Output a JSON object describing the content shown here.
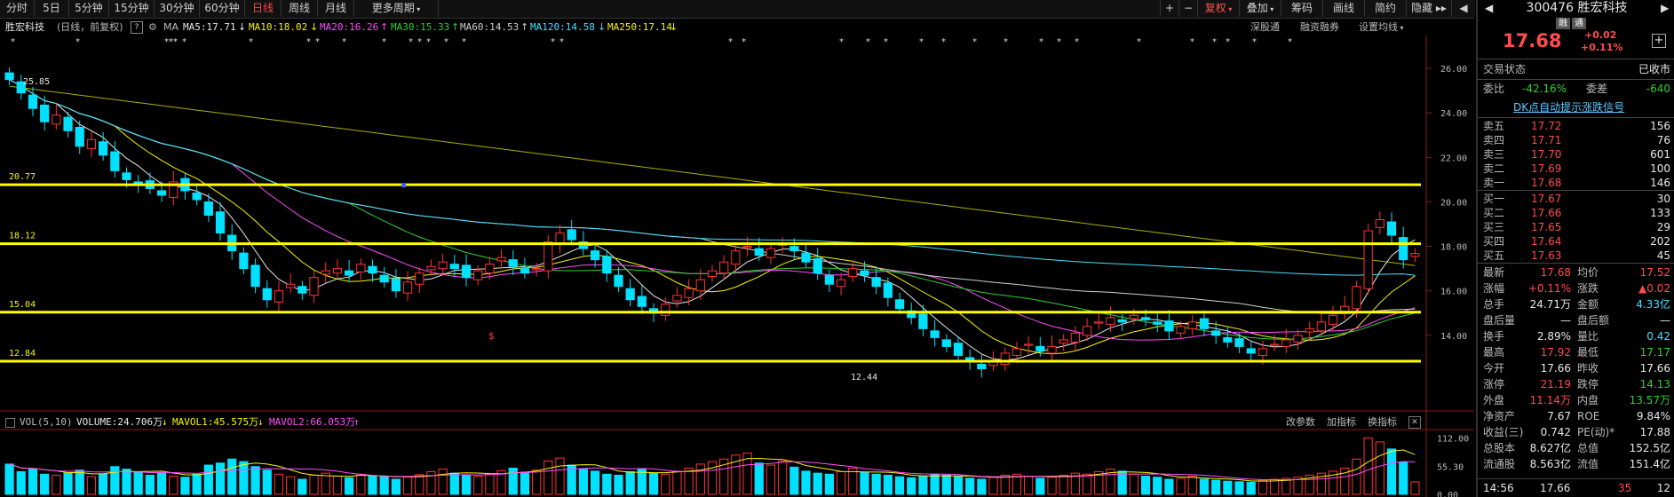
{
  "toolbar": {
    "periods": [
      "分时",
      "5日",
      "5分钟",
      "15分钟",
      "30分钟",
      "60分钟",
      "日线",
      "周线",
      "月线",
      "更多周期"
    ],
    "active_period": "日线",
    "right_items": [
      "+",
      "−",
      "复权",
      "叠加",
      "筹码",
      "画线",
      "简约",
      "隐藏"
    ],
    "active_right": "复权",
    "hide_arrow": "▸▸"
  },
  "infobar": {
    "name": "胜宏科技",
    "mode": "(日线，前复权)",
    "help": "?",
    "ma_label": "MA",
    "ma": [
      {
        "text": "MA5:17.71",
        "arrow": "↓",
        "color": "#e8e8e8"
      },
      {
        "text": "MA10:18.02",
        "arrow": "↓",
        "color": "#f6f600"
      },
      {
        "text": "MA20:16.26",
        "arrow": "↑",
        "color": "#ff4cff"
      },
      {
        "text": "MA30:15.33",
        "arrow": "↑",
        "color": "#2fd12f"
      },
      {
        "text": "MA60:14.53",
        "arrow": "↑",
        "color": "#cfcfcf"
      },
      {
        "text": "MA120:14.58",
        "arrow": "↓",
        "color": "#45e0ff"
      },
      {
        "text": "MA250:17.14",
        "arrow": "↓",
        "color": "#f6f600"
      }
    ],
    "right_links": [
      "深股通",
      "融资融券",
      "设置均线"
    ]
  },
  "price_levels": [
    {
      "value": 20.77,
      "label": "20.77"
    },
    {
      "value": 18.12,
      "label": "18.12"
    },
    {
      "value": 15.04,
      "label": "15.04"
    },
    {
      "value": 12.84,
      "label": "12.84"
    }
  ],
  "price_annotations": {
    "high": "25.85",
    "low": "12.44"
  },
  "price_axis": [
    "26.00",
    "24.00",
    "22.00",
    "20.00",
    "18.00",
    "16.00",
    "14.00"
  ],
  "vol_bar": {
    "label": "VOL(5,10)",
    "volume": "VOLUME:24.706万",
    "mavol1": "MAVOL1:45.575万",
    "mavol2": "MAVOL2:66.053万",
    "mavol1_arrow": "↓",
    "mavol2_arrow": "↑",
    "links": [
      "改参数",
      "加指标",
      "换指标"
    ],
    "close": "✕"
  },
  "vol_axis": [
    "112.00",
    "55.30",
    "0.00"
  ],
  "chart_data": {
    "type": "candlestick",
    "price_range": [
      12.44,
      25.85
    ],
    "closes": [
      25.5,
      24.9,
      24.2,
      23.6,
      23.9,
      23.2,
      22.5,
      22.8,
      22.1,
      21.4,
      21.0,
      20.8,
      20.6,
      20.3,
      20.9,
      20.5,
      20.1,
      19.4,
      18.6,
      17.8,
      17.0,
      16.2,
      15.6,
      16.0,
      16.3,
      15.9,
      16.6,
      16.9,
      17.0,
      16.7,
      17.2,
      16.8,
      16.4,
      16.0,
      16.4,
      16.8,
      17.1,
      17.3,
      17.0,
      16.6,
      16.9,
      17.2,
      17.5,
      17.1,
      16.8,
      17.0,
      18.2,
      18.6,
      18.3,
      17.9,
      17.4,
      16.8,
      16.2,
      15.6,
      15.3,
      15.0,
      15.4,
      15.8,
      16.1,
      16.5,
      16.9,
      17.3,
      17.8,
      18.0,
      17.6,
      17.9,
      18.1,
      17.8,
      17.3,
      16.8,
      16.3,
      16.5,
      17.0,
      16.7,
      16.2,
      15.7,
      15.2,
      14.8,
      14.3,
      13.9,
      13.5,
      13.1,
      12.8,
      12.5,
      12.8,
      13.2,
      13.4,
      13.6,
      13.3,
      13.5,
      13.8,
      14.1,
      14.4,
      14.6,
      14.8,
      14.6,
      14.9,
      14.7,
      14.5,
      14.2,
      14.4,
      14.6,
      14.3,
      14.0,
      13.7,
      13.5,
      13.2,
      13.4,
      13.6,
      13.8,
      14.0,
      14.3,
      14.6,
      14.9,
      15.3,
      16.2,
      18.7,
      19.2,
      18.5,
      17.4,
      17.68
    ],
    "volumes_wan": [
      60,
      45,
      50,
      40,
      38,
      42,
      48,
      35,
      40,
      55,
      50,
      45,
      38,
      42,
      36,
      34,
      40,
      58,
      62,
      70,
      65,
      55,
      48,
      40,
      35,
      30,
      38,
      42,
      36,
      33,
      40,
      37,
      35,
      30,
      34,
      39,
      45,
      50,
      42,
      38,
      36,
      40,
      47,
      52,
      44,
      48,
      66,
      72,
      58,
      50,
      46,
      40,
      38,
      45,
      50,
      42,
      40,
      46,
      52,
      60,
      65,
      70,
      78,
      82,
      62,
      58,
      66,
      54,
      46,
      42,
      40,
      45,
      52,
      44,
      40,
      38,
      35,
      33,
      36,
      40,
      38,
      35,
      32,
      30,
      34,
      38,
      40,
      36,
      32,
      34,
      38,
      42,
      40,
      45,
      50,
      46,
      40,
      36,
      34,
      30,
      32,
      36,
      30,
      28,
      26,
      25,
      24,
      28,
      30,
      32,
      34,
      38,
      42,
      46,
      52,
      70,
      112,
      104,
      90,
      64,
      24.7
    ]
  },
  "right_panel": {
    "code": "300476",
    "name": "胜宏科技",
    "tags": [
      "融",
      "通"
    ],
    "price": "17.68",
    "change": "+0.02",
    "change_pct": "+0.11%",
    "add": "+",
    "status_label": "交易状态",
    "status_value": "已收市",
    "weibi_label": "委比",
    "weibi_value": "-42.16%",
    "weicha_label": "委差",
    "weicha_value": "-640",
    "dk_link": "DK点自动提示涨跌信号",
    "asks": [
      {
        "label": "卖五",
        "price": "17.72",
        "vol": "156"
      },
      {
        "label": "卖四",
        "price": "17.71",
        "vol": "76"
      },
      {
        "label": "卖三",
        "price": "17.70",
        "vol": "601"
      },
      {
        "label": "卖二",
        "price": "17.69",
        "vol": "100"
      },
      {
        "label": "卖一",
        "price": "17.68",
        "vol": "146"
      }
    ],
    "bids": [
      {
        "label": "买一",
        "price": "17.67",
        "vol": "30"
      },
      {
        "label": "买二",
        "price": "17.66",
        "vol": "133"
      },
      {
        "label": "买三",
        "price": "17.65",
        "vol": "29"
      },
      {
        "label": "买四",
        "price": "17.64",
        "vol": "202"
      },
      {
        "label": "买五",
        "price": "17.63",
        "vol": "45"
      }
    ],
    "stats": [
      {
        "l1": "最新",
        "v1": "17.68",
        "c1": "red",
        "l2": "均价",
        "v2": "17.52",
        "c2": "red"
      },
      {
        "l1": "涨幅",
        "v1": "+0.11%",
        "c1": "red",
        "l2": "涨跌",
        "v2": "▲0.02",
        "c2": "red"
      },
      {
        "l1": "总手",
        "v1": "24.71万",
        "c1": "wht",
        "l2": "金额",
        "v2": "4.33亿",
        "c2": "cyn"
      },
      {
        "l1": "盘后量",
        "v1": "—",
        "c1": "wht",
        "l2": "盘后额",
        "v2": "—",
        "c2": "wht"
      },
      {
        "l1": "换手",
        "v1": "2.89%",
        "c1": "wht",
        "l2": "量比",
        "v2": "0.42",
        "c2": "cyn"
      },
      {
        "l1": "最高",
        "v1": "17.92",
        "c1": "red",
        "l2": "最低",
        "v2": "17.17",
        "c2": "grn"
      },
      {
        "l1": "今开",
        "v1": "17.66",
        "c1": "wht",
        "l2": "昨收",
        "v2": "17.66",
        "c2": "wht"
      },
      {
        "l1": "涨停",
        "v1": "21.19",
        "c1": "red",
        "l2": "跌停",
        "v2": "14.13",
        "c2": "grn"
      },
      {
        "l1": "外盘",
        "v1": "11.14万",
        "c1": "red",
        "l2": "内盘",
        "v2": "13.57万",
        "c2": "grn"
      },
      {
        "l1": "净资产",
        "v1": "7.67",
        "c1": "wht",
        "l2": "ROE",
        "v2": "9.84%",
        "c2": "wht"
      },
      {
        "l1": "收益(三)",
        "v1": "0.742",
        "c1": "wht",
        "l2": "PE(动)*",
        "v2": "17.88",
        "c2": "wht"
      },
      {
        "l1": "总股本",
        "v1": "8.627亿",
        "c1": "wht",
        "l2": "总值",
        "v2": "152.5亿",
        "c2": "wht"
      },
      {
        "l1": "流通股",
        "v1": "8.563亿",
        "c1": "wht",
        "l2": "流值",
        "v2": "151.4亿",
        "c2": "wht"
      }
    ],
    "tick": {
      "time": "14:56",
      "price": "17.66",
      "vol": "35",
      "count": "12"
    }
  },
  "colors": {
    "up": "#ff3232",
    "down": "#00e0ff",
    "level": "#ffff00"
  }
}
